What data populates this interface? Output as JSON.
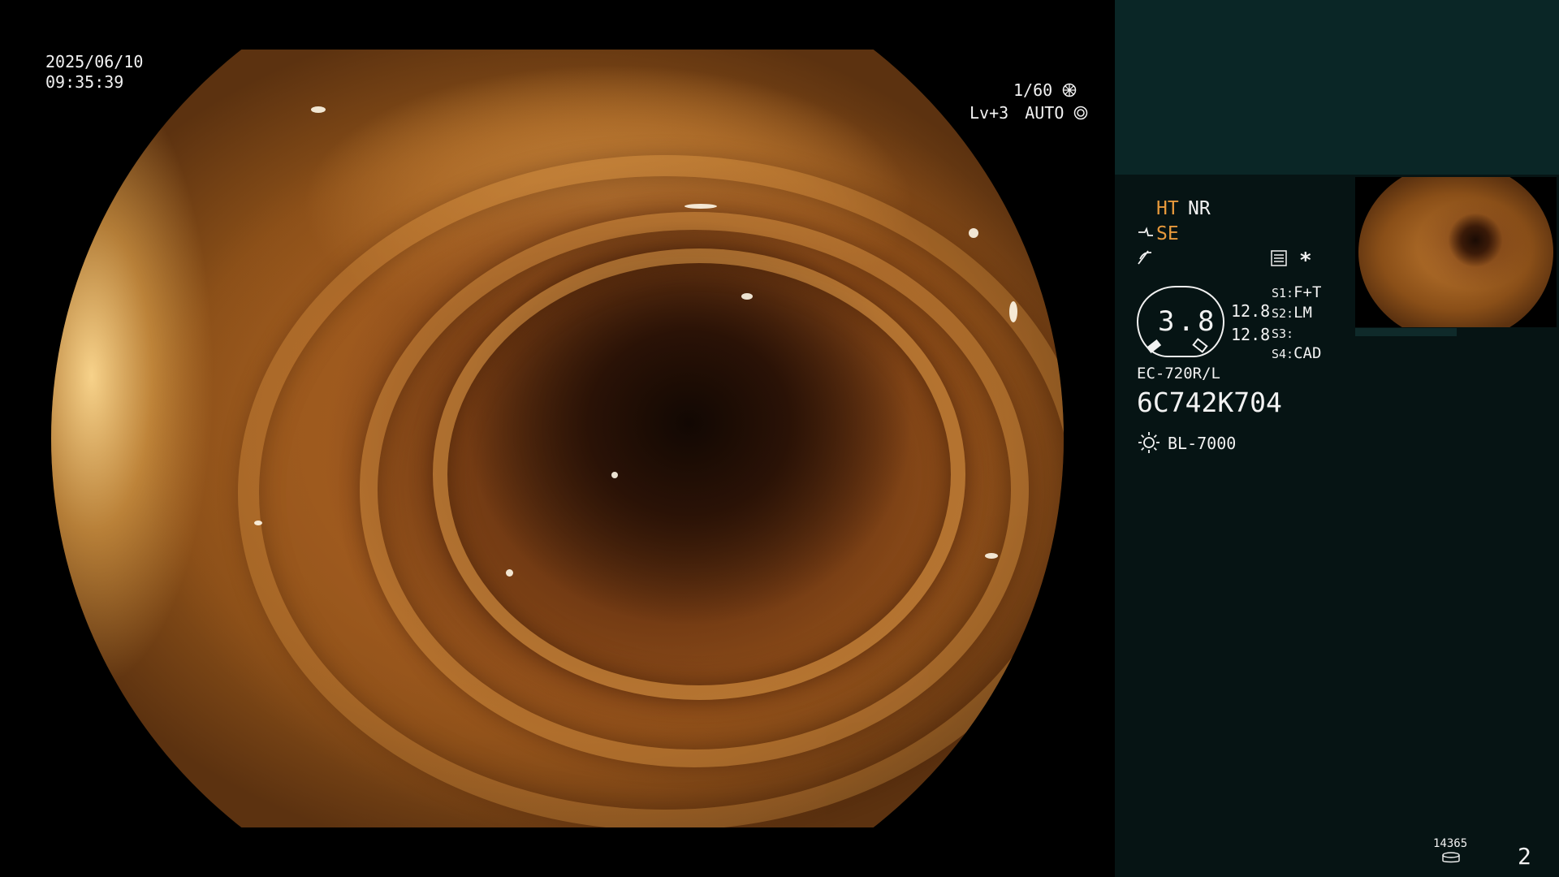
{
  "header": {
    "date": "2025/06/10",
    "time": "09:35:39",
    "shutter": "1/60",
    "level": "Lv+3",
    "mode": "AUTO"
  },
  "panel": {
    "ht": "HT",
    "nr": "NR",
    "se": "SE",
    "value_main": "3.8",
    "value_a": "12.8",
    "value_b": "12.8",
    "asterisk": "*",
    "settings": [
      {
        "key": "S1:",
        "value": "F+T"
      },
      {
        "key": "S2:",
        "value": "LM"
      },
      {
        "key": "S3:",
        "value": ""
      },
      {
        "key": "S4:",
        "value": "CAD"
      }
    ],
    "scope_model": "EC-720R/L",
    "serial": "6C742K704",
    "light_source": "BL-7000",
    "counter": "14365",
    "index": "2"
  },
  "colors": {
    "accent_orange": "#e89a3c",
    "panel_bg": "#061414",
    "panel_top_bg": "#0a2626"
  },
  "icons": [
    "shutter-icon",
    "auto-iris-icon",
    "scope-icon",
    "flicker-icon",
    "menu-icon",
    "light-icon",
    "storage-icon"
  ]
}
